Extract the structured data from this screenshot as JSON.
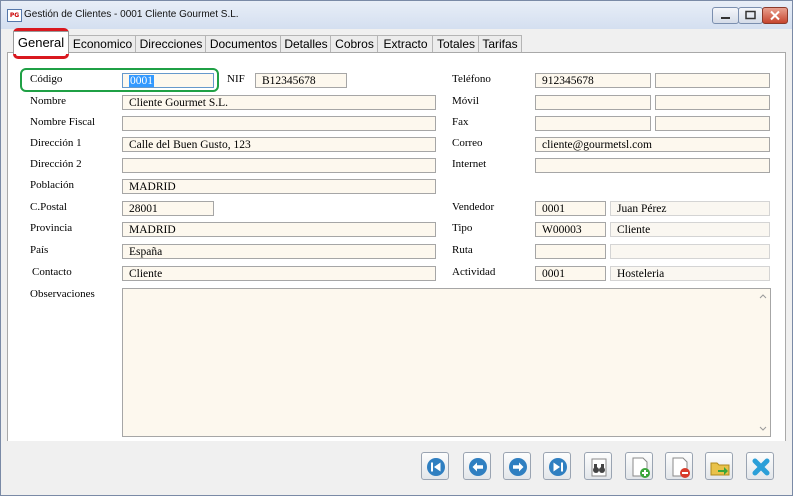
{
  "window": {
    "title": "Gestión de Clientes - 0001 Cliente Gourmet S.L.",
    "app_icon_text": "PG"
  },
  "tabs": [
    "General",
    "Economico",
    "Direcciones",
    "Documentos",
    "Detalles",
    "Cobros",
    "Extracto",
    "Totales",
    "Tarifas"
  ],
  "active_tab": "General",
  "form": {
    "codigo": {
      "label": "Código",
      "value": "0001"
    },
    "nif": {
      "label": "NIF",
      "value": "B12345678"
    },
    "nombre": {
      "label": "Nombre",
      "value": "Cliente Gourmet S.L."
    },
    "nombre_fiscal": {
      "label": "Nombre Fiscal",
      "value": ""
    },
    "direccion1": {
      "label": "Dirección 1",
      "value": "Calle del Buen Gusto, 123"
    },
    "direccion2": {
      "label": "Dirección 2",
      "value": ""
    },
    "poblacion": {
      "label": "Población",
      "value": "MADRID"
    },
    "cpostal": {
      "label": "C.Postal",
      "value": "28001"
    },
    "provincia": {
      "label": "Provincia",
      "value": "MADRID"
    },
    "pais": {
      "label": "País",
      "value": "España"
    },
    "contacto": {
      "label": "Contacto",
      "value": "Cliente"
    },
    "observaciones": {
      "label": "Observaciones",
      "value": ""
    },
    "telefono": {
      "label": "Teléfono",
      "value": "912345678",
      "value2": ""
    },
    "movil": {
      "label": "Móvil",
      "value": "",
      "value2": ""
    },
    "fax": {
      "label": "Fax",
      "value": "",
      "value2": ""
    },
    "correo": {
      "label": "Correo",
      "value": "cliente@gourmetsl.com"
    },
    "internet": {
      "label": "Internet",
      "value": ""
    },
    "vendedor": {
      "label": "Vendedor",
      "code": "0001",
      "name": "Juan Pérez"
    },
    "tipo": {
      "label": "Tipo",
      "code": "W00003",
      "name": "Cliente"
    },
    "ruta": {
      "label": "Ruta",
      "code": "",
      "name": ""
    },
    "actividad": {
      "label": "Actividad",
      "code": "0001",
      "name": "Hosteleria"
    }
  },
  "toolbar": {
    "buttons": [
      "first-record",
      "previous-record",
      "next-record",
      "last-record",
      "search",
      "new-record",
      "delete-record",
      "export",
      "close"
    ]
  },
  "colors": {
    "field_bg": "#fdf8ee",
    "highlight_red": "#d9181f",
    "highlight_green": "#1fa045",
    "nav_blue": "#2f7fc1",
    "close_x": "#2b9fd8"
  }
}
